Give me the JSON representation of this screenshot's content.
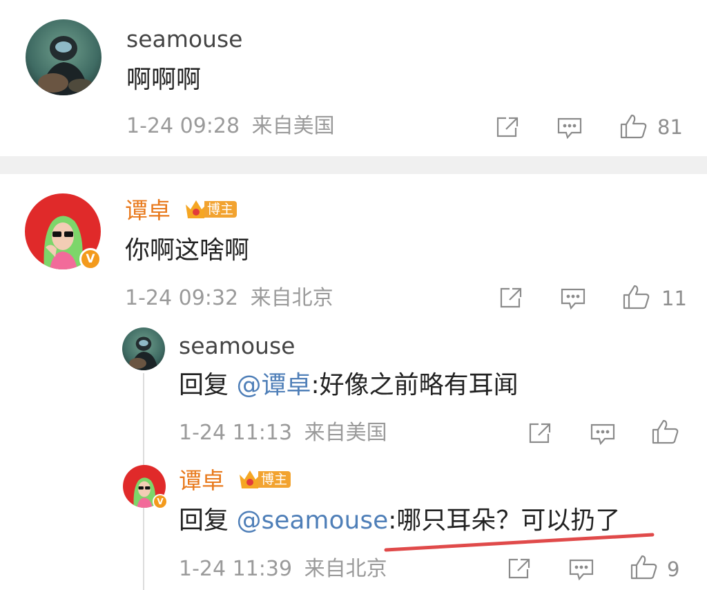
{
  "comments": [
    {
      "username": "seamouse",
      "text": "啊啊啊",
      "time": "1-24 09:28",
      "location": "来自美国",
      "likes": "81"
    },
    {
      "username": "谭卓",
      "badge": "博主",
      "text": "你啊这啥啊",
      "time": "1-24 09:32",
      "location": "来自北京",
      "likes": "11",
      "replies": [
        {
          "username": "seamouse",
          "reply_prefix": "回复",
          "mention": "@谭卓",
          "text": ":好像之前略有耳闻",
          "time": "1-24 11:13",
          "location": "来自美国",
          "likes": ""
        },
        {
          "username": "谭卓",
          "badge": "博主",
          "reply_prefix": "回复",
          "mention": "@seamouse",
          "text": ":哪只耳朵？可以扔了",
          "time": "1-24 11:39",
          "location": "来自北京",
          "likes": "9"
        }
      ]
    }
  ],
  "icons": {
    "share": "share-icon",
    "comment": "comment-icon",
    "like": "thumbs-up-icon",
    "verified": "verified-v-icon",
    "crown": "crown-icon"
  },
  "colors": {
    "vip_name": "#e8791c",
    "mention": "#4f7fb8",
    "badge": "#f2a330",
    "underline": "#e04a4a",
    "divider": "#f0f0f0"
  }
}
